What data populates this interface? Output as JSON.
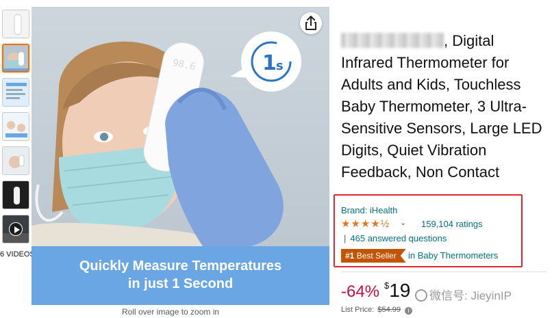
{
  "thumbnails": {
    "videos_label": "6 VIDEOS"
  },
  "main_image": {
    "banner_line1": "Quickly Measure Temperatures",
    "banner_line2": "in just 1 Second",
    "badge_number": "1",
    "badge_unit": "s",
    "device_display": "98.6",
    "zoom_hint": "Roll over image to zoom in"
  },
  "product": {
    "title_rest": ", Digital Infrared Thermometer for Adults and Kids, Touchless Baby Thermometer, 3 Ultra-Sensitive Sensors, Large LED Digits, Quiet Vibration Feedback, Non Contact",
    "brand": "Brand: iHealth",
    "stars": "★★★★½",
    "rating_value": 4.5,
    "ratings_count": "159,104 ratings",
    "answered_sep": "|",
    "answered_questions": "465 answered questions",
    "best_seller_rank": "#1",
    "best_seller_label": "Best Seller",
    "best_seller_category": "in Baby Thermometers",
    "discount": "-64%",
    "price_symbol": "$",
    "price_whole": "19",
    "list_price_label": "List Price:",
    "list_price_value": "$54.99"
  },
  "watermark": {
    "text": "微信号: JieyinIP"
  },
  "colors": {
    "accent_orange": "#e77600",
    "link_teal": "#007185",
    "discount_red": "#cc0c39",
    "highlight_box": "#e3262e",
    "best_seller": "#c45500",
    "banner_blue": "#6aa6e4"
  }
}
